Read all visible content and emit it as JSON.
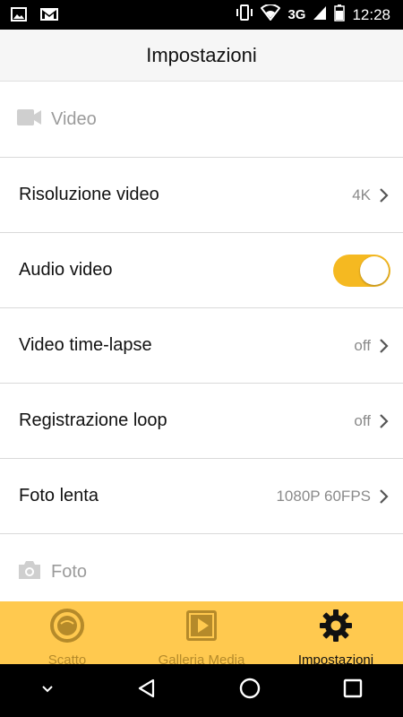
{
  "status_bar": {
    "time": "12:28",
    "network": "3G",
    "icons": [
      "image-icon",
      "gmail-icon",
      "vibrate-icon",
      "wifi-icon",
      "signal-icon",
      "battery-icon"
    ]
  },
  "header": {
    "title": "Impostazioni"
  },
  "sections": {
    "video": {
      "label": "Video",
      "icon": "video-camera-icon"
    },
    "foto": {
      "label": "Foto",
      "icon": "photo-camera-icon"
    }
  },
  "rows": [
    {
      "label": "Risoluzione video",
      "value": "4K"
    },
    {
      "label": "Audio video",
      "toggle_on": true
    },
    {
      "label": "Video time-lapse",
      "value": "off"
    },
    {
      "label": "Registrazione loop",
      "value": "off"
    },
    {
      "label": "Foto lenta",
      "value": "1080P 60FPS"
    }
  ],
  "tabs": [
    {
      "label": "Scatto",
      "icon": "shutter-icon",
      "active": false
    },
    {
      "label": "Galleria Media",
      "icon": "gallery-play-icon",
      "active": false
    },
    {
      "label": "Impostazioni",
      "icon": "gear-icon",
      "active": true
    }
  ],
  "colors": {
    "accent": "#ffc94f",
    "toggle": "#f5b921",
    "inactive_tab": "#b58a2a"
  },
  "nav_bar": {
    "icons": [
      "chevron-down-icon",
      "back-icon",
      "home-icon",
      "recents-icon"
    ]
  }
}
